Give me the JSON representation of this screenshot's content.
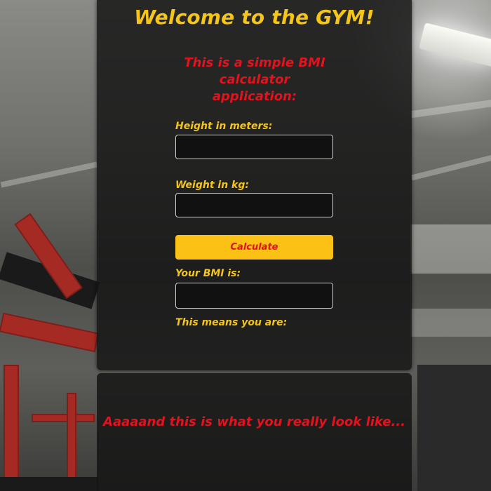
{
  "header": {
    "title": "Welcome to the GYM!",
    "subtitle": "This is a simple BMI calculator application:"
  },
  "form": {
    "height_label": "Height in meters:",
    "height_value": "",
    "weight_label": "Weight in kg:",
    "weight_value": "",
    "calculate_label": "Calculate",
    "bmi_label": "Your BMI is:",
    "bmi_value": "",
    "meaning_label": "This means you are:"
  },
  "footer": {
    "looks_text": "Aaaaand this is what you really look like..."
  },
  "colors": {
    "accent_yellow": "#f5c518",
    "accent_red": "#e3121c",
    "button_yellow": "#fbc115",
    "panel_bg": "rgba(20,20,20,0.84)"
  }
}
